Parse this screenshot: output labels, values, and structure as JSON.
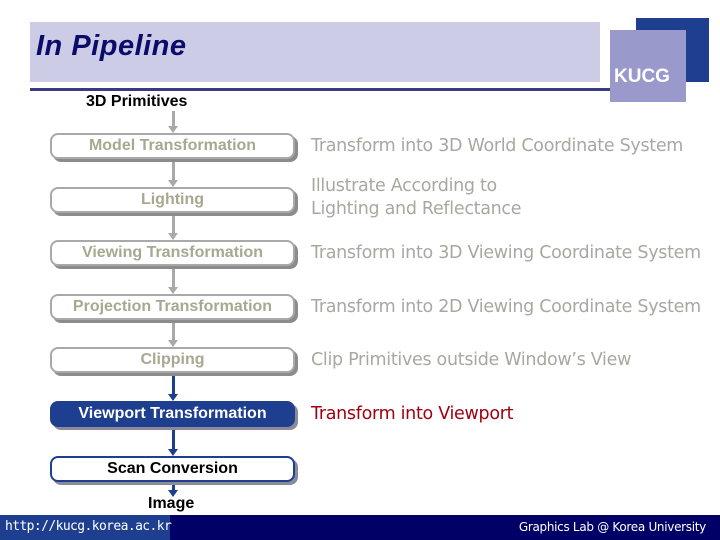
{
  "header": {
    "title": "In Pipeline",
    "logo_text": "KUCG"
  },
  "pipeline": {
    "input_label": "3D Primitives",
    "output_label": "Image",
    "stages": [
      {
        "label": "Model Transformation",
        "description": "Transform into 3D World Coordinate System",
        "state": "done"
      },
      {
        "label": "Lighting",
        "description": "Illustrate According to\nLighting and Reflectance",
        "description_lines": [
          "Illustrate According to",
          "Lighting and Reflectance"
        ],
        "state": "done"
      },
      {
        "label": "Viewing Transformation",
        "description": "Transform into 3D Viewing Coordinate System",
        "state": "done"
      },
      {
        "label": "Projection Transformation",
        "description": "Transform into 2D Viewing Coordinate System",
        "state": "done"
      },
      {
        "label": "Clipping",
        "description": "Clip Primitives outside Window’s View",
        "state": "done"
      },
      {
        "label": "Viewport Transformation",
        "description": "Transform into Viewport",
        "state": "active"
      },
      {
        "label": "Scan Conversion",
        "description": "",
        "state": "future"
      }
    ]
  },
  "footer": {
    "url": "http://kucg.korea.ac.kr",
    "lab": "Graphics Lab @ Korea University"
  },
  "colors": {
    "header_band": "#cccce6",
    "title": "#0b0b6b",
    "logo_back": "#1e3f8f",
    "logo_front": "#9999cc",
    "done_text": "#a8a890",
    "active_fill": "#1e3f8f",
    "active_description": "#a00010",
    "footer_left": "#1e3f8f",
    "footer_right": "#000066"
  }
}
